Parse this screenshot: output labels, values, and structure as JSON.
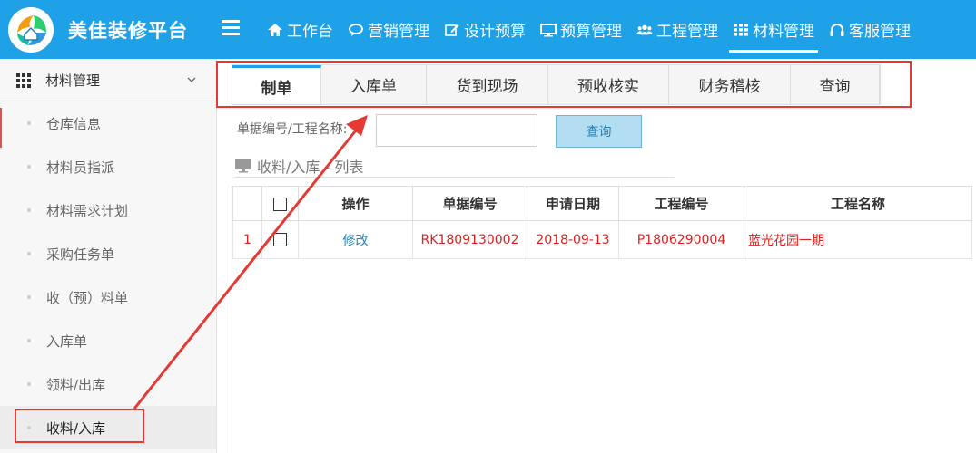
{
  "app": {
    "title": "美佳装修平台",
    "logo_icon": "home-leaf-logo"
  },
  "topnav": [
    {
      "label": "工作台",
      "icon": "home-icon",
      "active": false
    },
    {
      "label": "营销管理",
      "icon": "chat-icon",
      "active": false
    },
    {
      "label": "设计预算",
      "icon": "edit-icon",
      "active": false
    },
    {
      "label": "预算管理",
      "icon": "monitor-icon",
      "active": false
    },
    {
      "label": "工程管理",
      "icon": "users-icon",
      "active": false
    },
    {
      "label": "材料管理",
      "icon": "grid-icon",
      "active": true
    },
    {
      "label": "客服管理",
      "icon": "headset-icon",
      "active": false
    }
  ],
  "sidebar": {
    "header": "材料管理",
    "items": [
      {
        "label": "仓库信息"
      },
      {
        "label": "材料员指派"
      },
      {
        "label": "材料需求计划"
      },
      {
        "label": "采购任务单"
      },
      {
        "label": "收（预）料单"
      },
      {
        "label": "入库单"
      },
      {
        "label": "领料/出库"
      },
      {
        "label": "收料/入库",
        "active": true
      }
    ]
  },
  "tabs": [
    "制单",
    "入库单",
    "货到现场",
    "预收核实",
    "财务稽核",
    "查询"
  ],
  "search": {
    "label": "单据编号/工程名称:",
    "value": "",
    "button": "查询"
  },
  "section_title": "收料/入库 - 列表",
  "table": {
    "headers": [
      "操作",
      "单据编号",
      "申请日期",
      "工程编号",
      "工程名称"
    ],
    "rows": [
      {
        "num": "1",
        "action": "修改",
        "doc_no": "RK1809130002",
        "date": "2018-09-13",
        "project_no": "P1806290004",
        "project_name": "蓝光花园一期"
      }
    ]
  },
  "colors": {
    "brand": "#1ea1e6",
    "annotation": "#e53935",
    "row_text": "#e02020",
    "link": "#2a7fb0"
  }
}
